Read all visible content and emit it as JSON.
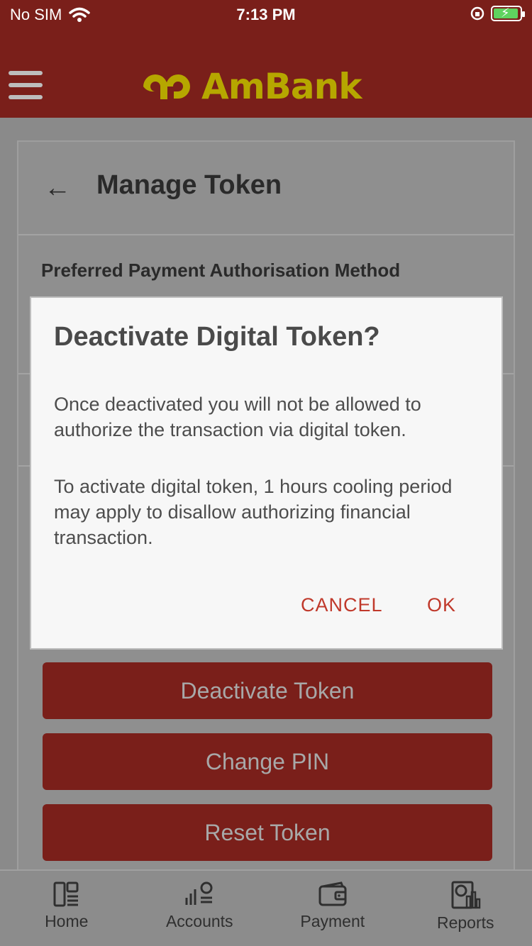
{
  "status_bar": {
    "carrier": "No SIM",
    "time": "7:13 PM"
  },
  "header": {
    "brand": "AmBank",
    "brand_color": "#b6a700"
  },
  "page": {
    "title": "Manage Token",
    "section_label": "Preferred Payment Authorisation Method"
  },
  "actions": [
    {
      "label": "Deactivate Token"
    },
    {
      "label": "Change PIN"
    },
    {
      "label": "Reset Token"
    }
  ],
  "dialog": {
    "title": "Deactivate Digital Token?",
    "message_1": "Once deactivated you will not be allowed to authorize the transaction via digital token.",
    "message_2": "To activate digital token, 1 hours cooling period may apply to disallow authorizing financial transaction.",
    "cancel_label": "CANCEL",
    "ok_label": "OK",
    "accent": "#c0392b"
  },
  "tabs": [
    {
      "label": "Home",
      "icon": "home-icon"
    },
    {
      "label": "Accounts",
      "icon": "accounts-icon"
    },
    {
      "label": "Payment",
      "icon": "wallet-icon"
    },
    {
      "label": "Reports",
      "icon": "reports-icon"
    }
  ],
  "colors": {
    "primary": "#b5261e",
    "overlay_dim": "#8a8a8a"
  }
}
